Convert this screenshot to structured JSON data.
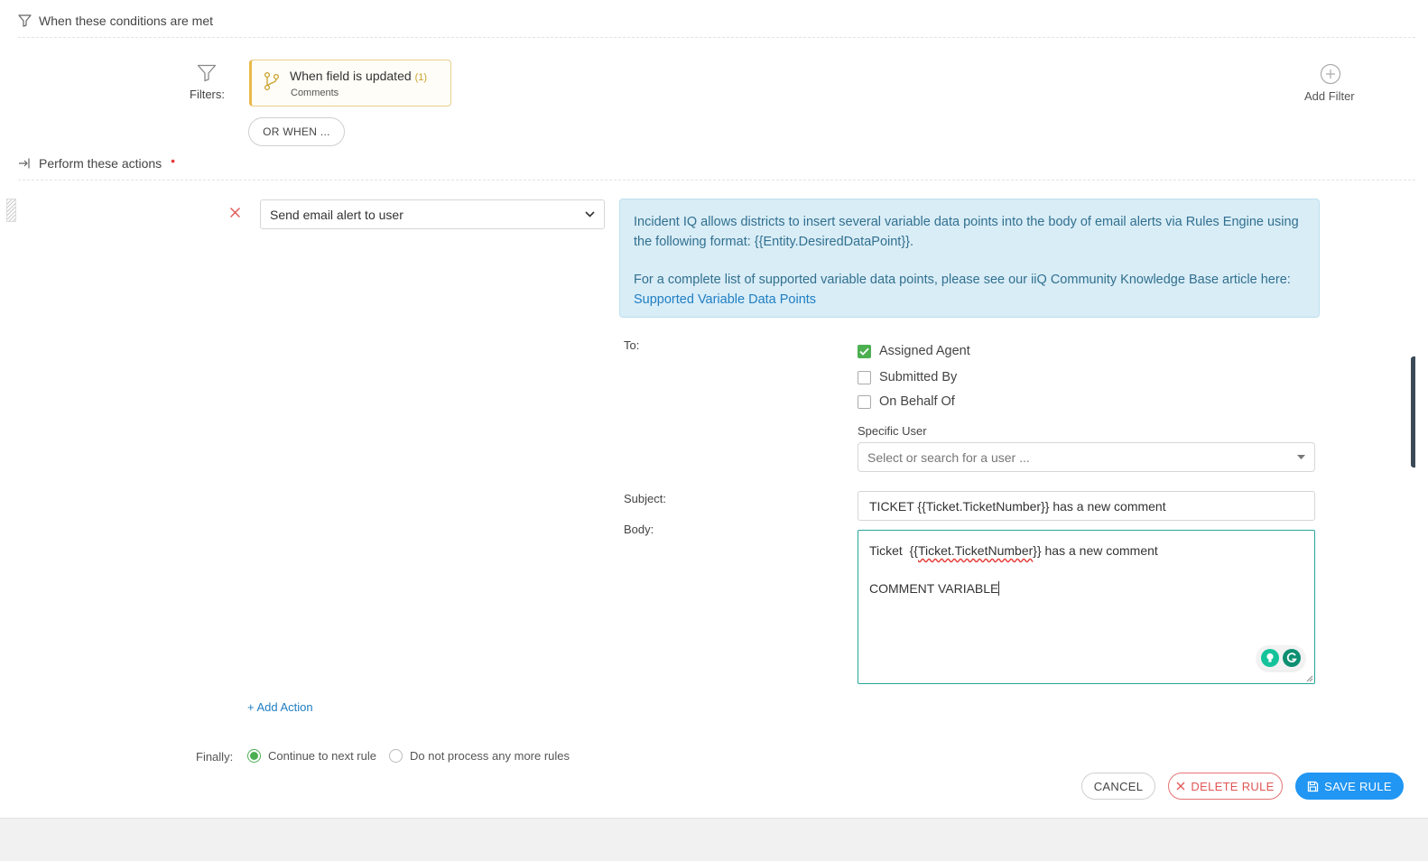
{
  "conditions": {
    "title": "When these conditions are met",
    "filters_label": "Filters:",
    "filter_card": {
      "title": "When field is updated",
      "count": "(1)",
      "subtitle": "Comments"
    },
    "or_when_label": "OR WHEN ...",
    "add_filter_label": "Add Filter"
  },
  "actions": {
    "title": "Perform these actions",
    "required_mark": "•",
    "action_select_value": "Send email alert to user",
    "info": {
      "paragraph1": "Incident IQ allows districts to insert several variable data points into the body of email alerts via Rules Engine using the following format: {{Entity.DesiredDataPoint}}.",
      "paragraph2_prefix": "For a complete list of supported variable data points, please see our iiQ Community Knowledge Base article here: ",
      "link_text": "Supported Variable Data Points"
    },
    "to_label": "To:",
    "recipients": [
      {
        "label": "Assigned Agent",
        "checked": true
      },
      {
        "label": "Submitted By",
        "checked": false
      },
      {
        "label": "On Behalf Of",
        "checked": false
      }
    ],
    "specific_user_label": "Specific User",
    "specific_user_placeholder": "Select or search for a user ...",
    "subject_label": "Subject:",
    "subject_value": "TICKET {{Ticket.TicketNumber}} has a new comment",
    "body_label": "Body:",
    "body_line1_prefix": "Ticket  {{",
    "body_line1_var": "Ticket.TicketNumber",
    "body_line1_suffix": "}} has a new comment",
    "body_line2": "COMMENT VARIABLE",
    "add_action_label": "+ Add Action"
  },
  "finally": {
    "label": "Finally:",
    "options": [
      {
        "label": "Continue to next rule",
        "selected": true
      },
      {
        "label": "Do not process any more rules",
        "selected": false
      }
    ]
  },
  "buttons": {
    "cancel": "CANCEL",
    "delete": "DELETE RULE",
    "save": "SAVE RULE"
  },
  "colors": {
    "accent_blue": "#2196f3",
    "success_green": "#4caf50",
    "danger_red": "#e05555",
    "info_bg": "#d9edf7",
    "filter_gold": "#e9b949"
  }
}
